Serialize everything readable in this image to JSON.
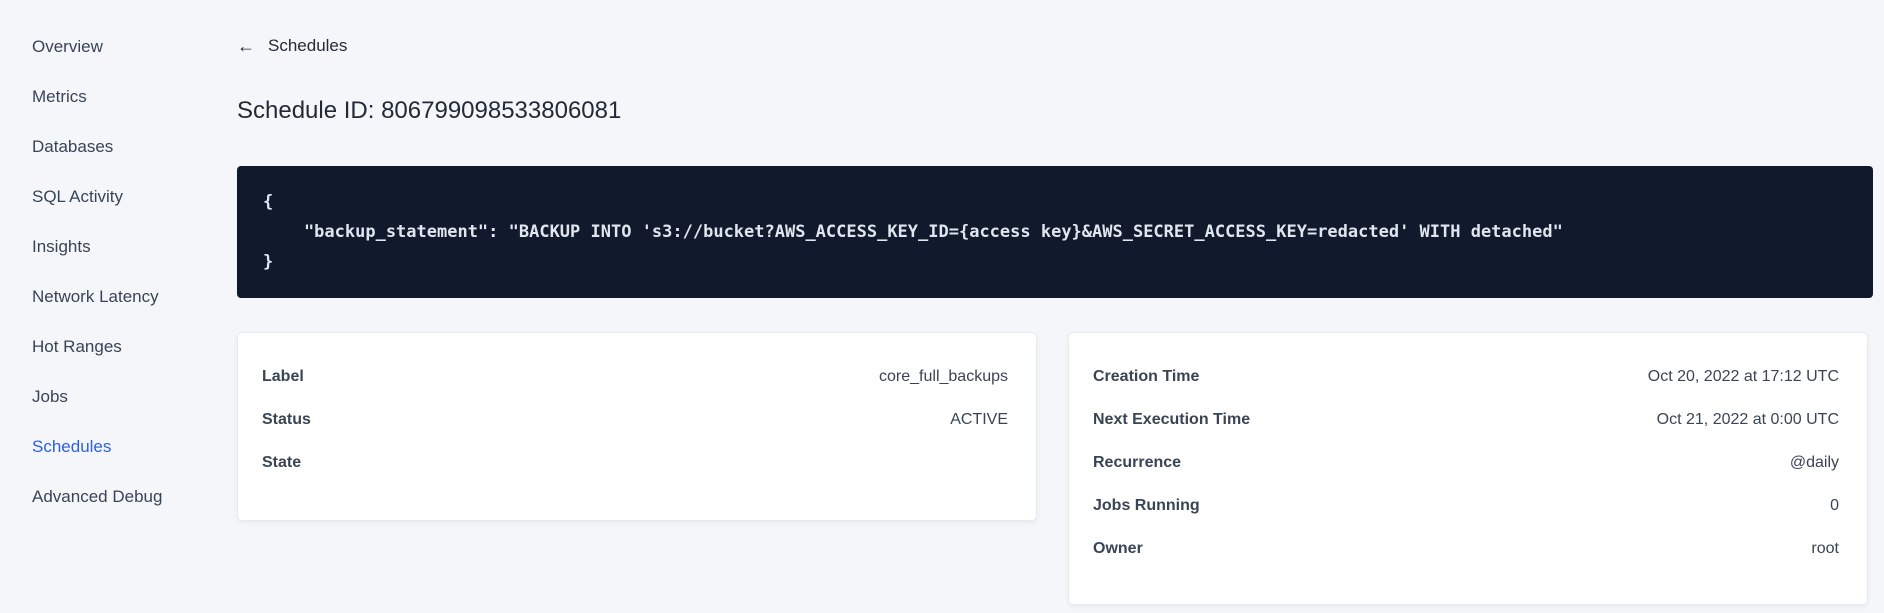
{
  "sidebar": {
    "items": [
      {
        "label": "Overview",
        "active": false
      },
      {
        "label": "Metrics",
        "active": false
      },
      {
        "label": "Databases",
        "active": false
      },
      {
        "label": "SQL Activity",
        "active": false
      },
      {
        "label": "Insights",
        "active": false
      },
      {
        "label": "Network Latency",
        "active": false
      },
      {
        "label": "Hot Ranges",
        "active": false
      },
      {
        "label": "Jobs",
        "active": false
      },
      {
        "label": "Schedules",
        "active": true
      },
      {
        "label": "Advanced Debug",
        "active": false
      }
    ]
  },
  "header": {
    "back_icon": "←",
    "back_label": "Schedules",
    "title": "Schedule ID: 806799098533806081"
  },
  "code_block": {
    "lines": [
      "{",
      "    \"backup_statement\": \"BACKUP INTO 's3://bucket?AWS_ACCESS_KEY_ID={access key}&AWS_SECRET_ACCESS_KEY=redacted' WITH detached\"",
      "}"
    ]
  },
  "details_left": {
    "rows": [
      {
        "label": "Label",
        "value": "core_full_backups"
      },
      {
        "label": "Status",
        "value": "ACTIVE"
      },
      {
        "label": "State",
        "value": ""
      }
    ]
  },
  "details_right": {
    "rows": [
      {
        "label": "Creation Time",
        "value": "Oct 20, 2022 at 17:12 UTC"
      },
      {
        "label": "Next Execution Time",
        "value": "Oct 21, 2022 at 0:00 UTC"
      },
      {
        "label": "Recurrence",
        "value": "@daily"
      },
      {
        "label": "Jobs Running",
        "value": "0"
      },
      {
        "label": "Owner",
        "value": "root"
      }
    ]
  },
  "colors": {
    "accent_blue": "#2d5fe1",
    "code_background": "#101a2c",
    "page_background": "#f4f6fa"
  }
}
